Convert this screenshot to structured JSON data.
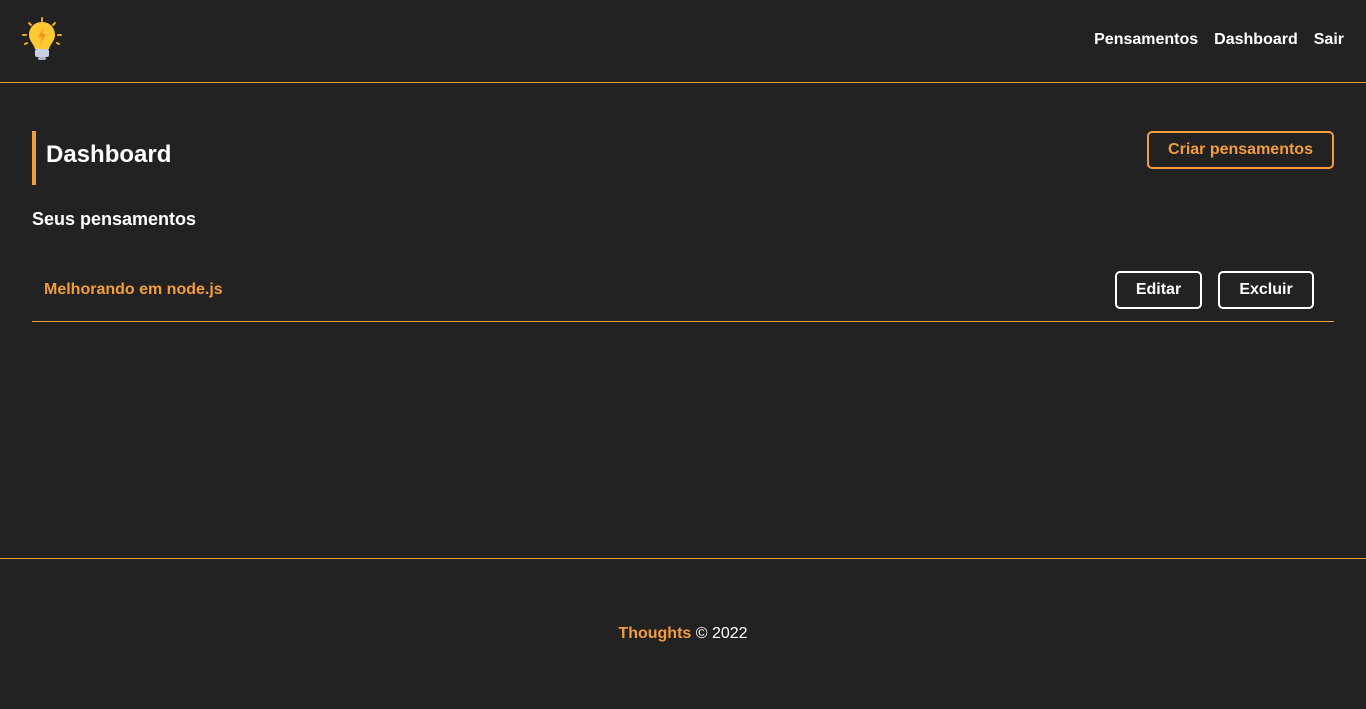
{
  "nav": {
    "logo_icon": "lightbulb-icon",
    "links": [
      "Pensamentos",
      "Dashboard",
      "Sair"
    ]
  },
  "main": {
    "title": "Dashboard",
    "create_button": "Criar pensamentos",
    "subtitle": "Seus pensamentos",
    "thoughts": [
      {
        "title": "Melhorando em node.js",
        "edit_label": "Editar",
        "delete_label": "Excluir"
      }
    ]
  },
  "footer": {
    "brand": "Thoughts",
    "copyright": "© 2022"
  },
  "colors": {
    "background": "#222222",
    "accent": "#f39c3c",
    "text": "#ffffff"
  }
}
